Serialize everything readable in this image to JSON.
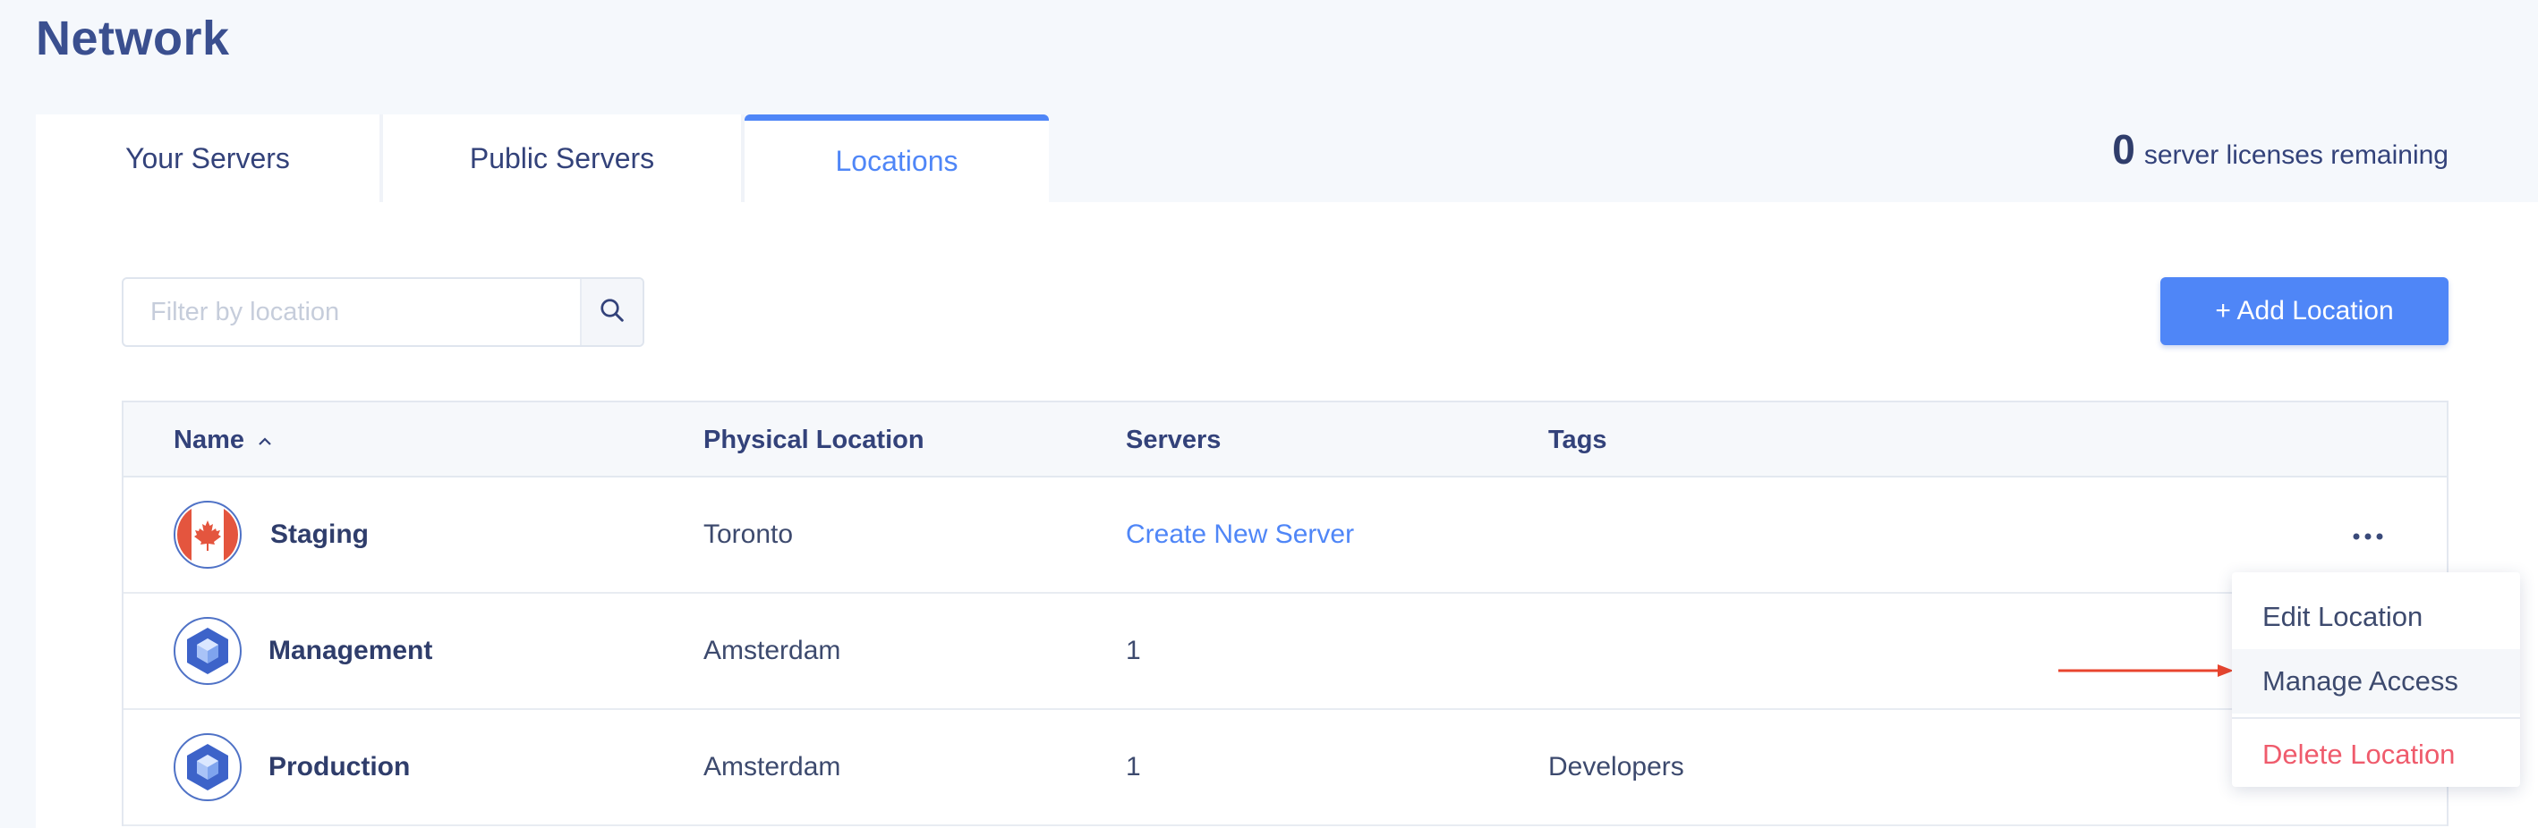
{
  "page": {
    "title": "Network"
  },
  "tabs": [
    {
      "label": "Your Servers"
    },
    {
      "label": "Public Servers"
    },
    {
      "label": "Locations"
    }
  ],
  "licenses": {
    "count": "0",
    "label": "server licenses remaining"
  },
  "search": {
    "placeholder": "Filter by location",
    "value": "",
    "icon": "search-icon"
  },
  "add_button": {
    "label": "+ Add Location"
  },
  "table": {
    "headers": {
      "name": "Name",
      "physical": "Physical Location",
      "servers": "Servers",
      "tags": "Tags"
    },
    "sort_indicator": "chevron-up-icon",
    "rows": [
      {
        "name": "Staging",
        "physical": "Toronto",
        "servers": "Create New Server",
        "tags": "",
        "icon": "canada-flag-icon"
      },
      {
        "name": "Management",
        "physical": "Amsterdam",
        "servers": "1",
        "tags": "",
        "icon": "cube-icon"
      },
      {
        "name": "Production",
        "physical": "Amsterdam",
        "servers": "1",
        "tags": "Developers",
        "icon": "cube-icon"
      }
    ]
  },
  "context_menu": {
    "items": [
      {
        "label": "Edit Location"
      },
      {
        "label": "Manage Access"
      },
      {
        "label": "Delete Location"
      }
    ]
  },
  "colors": {
    "accent": "#4f86f7",
    "title": "#3a4f8f",
    "danger": "#ef5b6c",
    "annotation_arrow": "#e8452e"
  }
}
